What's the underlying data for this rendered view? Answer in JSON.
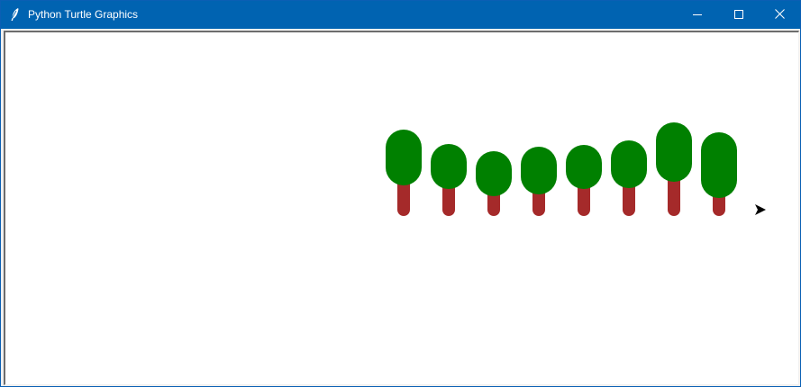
{
  "window": {
    "title": "Python Turtle Graphics",
    "icon": "feather-icon",
    "controls": [
      "minimize-icon",
      "maximize-icon",
      "close-icon"
    ]
  },
  "colors": {
    "titlebar": "#0063b1",
    "canvas_bg": "#ffffff",
    "foliage": "#008000",
    "trunk": "#a52a2a",
    "turtle": "#000000"
  },
  "canvas": {
    "trees": [
      {
        "index": 1
      },
      {
        "index": 2
      },
      {
        "index": 3
      },
      {
        "index": 4
      },
      {
        "index": 5
      },
      {
        "index": 6
      },
      {
        "index": 7
      },
      {
        "index": 8
      }
    ],
    "turtle": {
      "shape": "classic-arrow",
      "heading": "east"
    }
  }
}
